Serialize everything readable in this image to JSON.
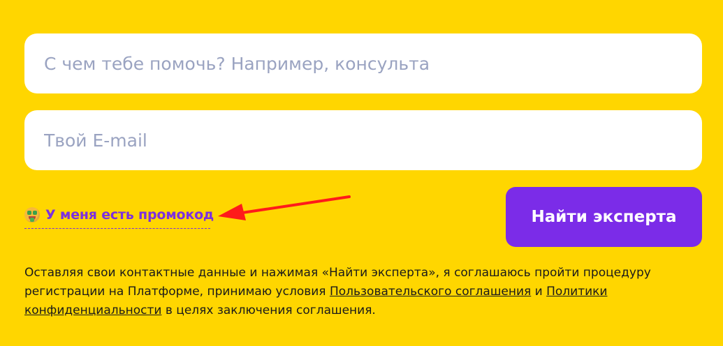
{
  "form": {
    "request_placeholder": "С чем тебе помочь? Например, консульта",
    "email_placeholder": "Твой E-mail",
    "promo_label": "У меня есть промокод",
    "submit_label": "Найти эксперта"
  },
  "consent": {
    "text_1": "Оставляя свои контактные данные и нажимая «Найти эксперта», я соглашаюсь пройти процедуру регистрации на Платформе, принимаю условия ",
    "link_terms": "Пользовательского соглашения",
    "text_2": " и ",
    "link_privacy": "Политики конфиденциальности",
    "text_3": " в целях заключения соглашения."
  },
  "icons": {
    "promo_emoji": "money-mouth-face-icon",
    "annotation": "red-arrow-icon"
  },
  "colors": {
    "background": "#FFD600",
    "accent": "#7B2CE8",
    "placeholder": "#9AA3C1",
    "arrow": "#FF1A1A"
  }
}
